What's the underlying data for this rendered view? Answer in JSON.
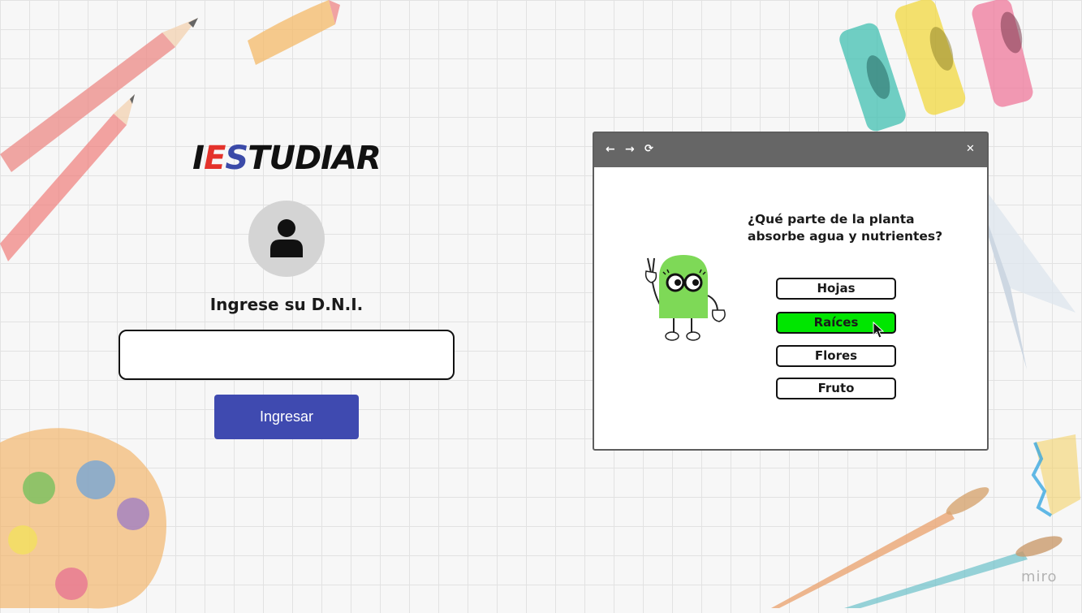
{
  "login": {
    "logo": {
      "part1": "I",
      "part2": "E",
      "part3": "S",
      "part4": "TUDIAR"
    },
    "dni_label": "Ingrese su D.N.I.",
    "dni_value": "",
    "dni_placeholder": "",
    "submit_label": "Ingresar"
  },
  "window": {
    "nav": {
      "back": "←",
      "forward": "→",
      "reload": "⟳",
      "close": "✕"
    },
    "question": "¿Qué parte de la planta absorbe agua y nutrientes?",
    "options": [
      {
        "label": "Hojas"
      },
      {
        "label": "Raíces",
        "selected": true
      },
      {
        "label": "Flores"
      },
      {
        "label": "Fruto"
      }
    ]
  },
  "watermark": "miro",
  "colors": {
    "logo_red": "#e4322b",
    "logo_blue": "#3b4aa8",
    "submit_button": "#3f4ab0",
    "selected_option": "#00e600",
    "titlebar": "#666666",
    "mascot": "#7ed957"
  }
}
